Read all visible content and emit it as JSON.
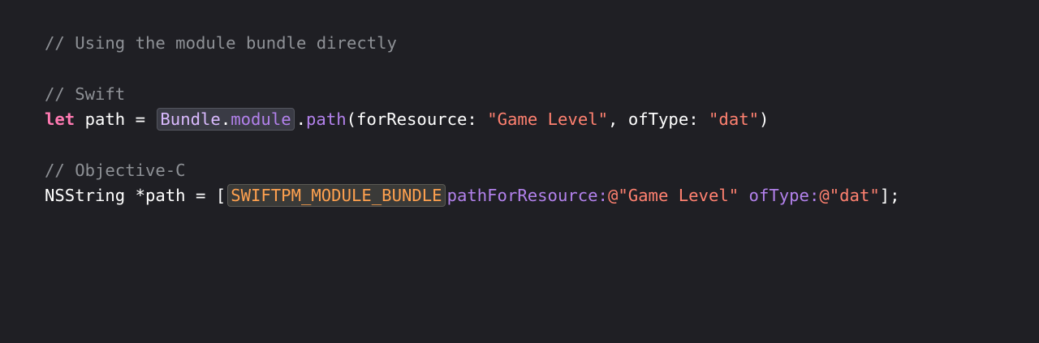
{
  "colors": {
    "background": "#1f1f24",
    "comment": "#8e9196",
    "keyword": "#ff7ab2",
    "string": "#ff8170",
    "method": "#b281eb",
    "type_ref": "#dabaff",
    "macro": "#ffa14f"
  },
  "code": {
    "comment_main": "// Using the module bundle directly",
    "comment_swift": "// Swift",
    "swift": {
      "keyword_let": "let",
      "text_path_assign": " path = ",
      "bundle_type": "Bundle",
      "dot1": ".",
      "module_prop": "module",
      "dot2": ".",
      "path_method": "path",
      "args_open": "(forResource: ",
      "resource_string": "\"Game Level\"",
      "args_mid": ", ofType: ",
      "type_string": "\"dat\"",
      "args_close": ")"
    },
    "comment_objc": "// Objective-C",
    "objc": {
      "decl": "NSString *path = [",
      "macro": "SWIFTPM_MODULE_BUNDLE",
      "space": " ",
      "selector1": "pathForResource:",
      "resource_string": "@\"Game Level\"",
      "space2": " ",
      "selector2": "ofType:",
      "type_string": "@\"dat\"",
      "close": "];"
    }
  }
}
